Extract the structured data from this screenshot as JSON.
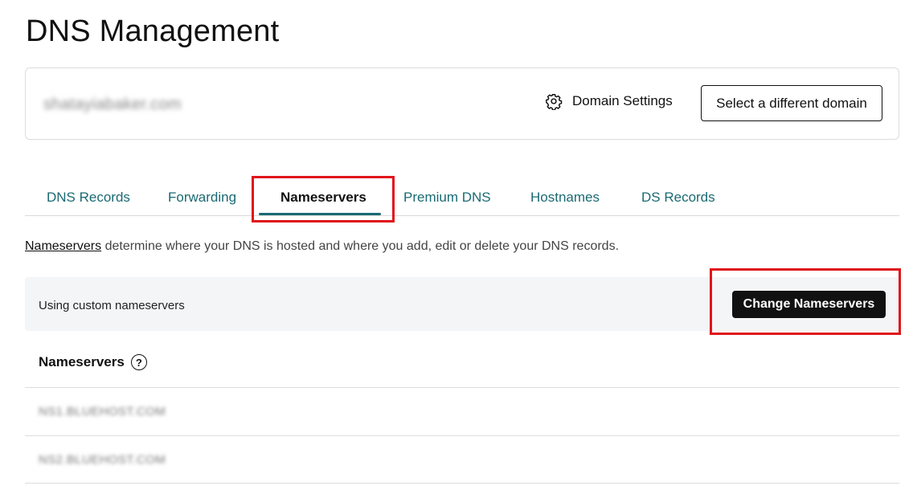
{
  "page": {
    "title": "DNS Management"
  },
  "domain_card": {
    "domain_name": "shatayiabaker.com",
    "settings_label": "Domain Settings",
    "settings_icon": "gear-icon",
    "select_domain_label": "Select a different domain"
  },
  "tabs": [
    {
      "label": "DNS Records",
      "active": false
    },
    {
      "label": "Forwarding",
      "active": false
    },
    {
      "label": "Nameservers",
      "active": true
    },
    {
      "label": "Premium DNS",
      "active": false
    },
    {
      "label": "Hostnames",
      "active": false
    },
    {
      "label": "DS Records",
      "active": false
    }
  ],
  "intro": {
    "link_text": "Nameservers",
    "text": " determine where your DNS is hosted and where you add, edit or delete your DNS records."
  },
  "status": {
    "text": "Using custom nameservers",
    "change_button_label": "Change Nameservers"
  },
  "nameservers": {
    "header": "Nameservers",
    "help_icon": "help-icon",
    "help_glyph": "?",
    "items": [
      "NS1.BLUEHOST.COM",
      "NS2.BLUEHOST.COM"
    ]
  },
  "colors": {
    "accent": "#1a6a73",
    "highlight": "#e0131a",
    "primary_button": "#111111"
  }
}
